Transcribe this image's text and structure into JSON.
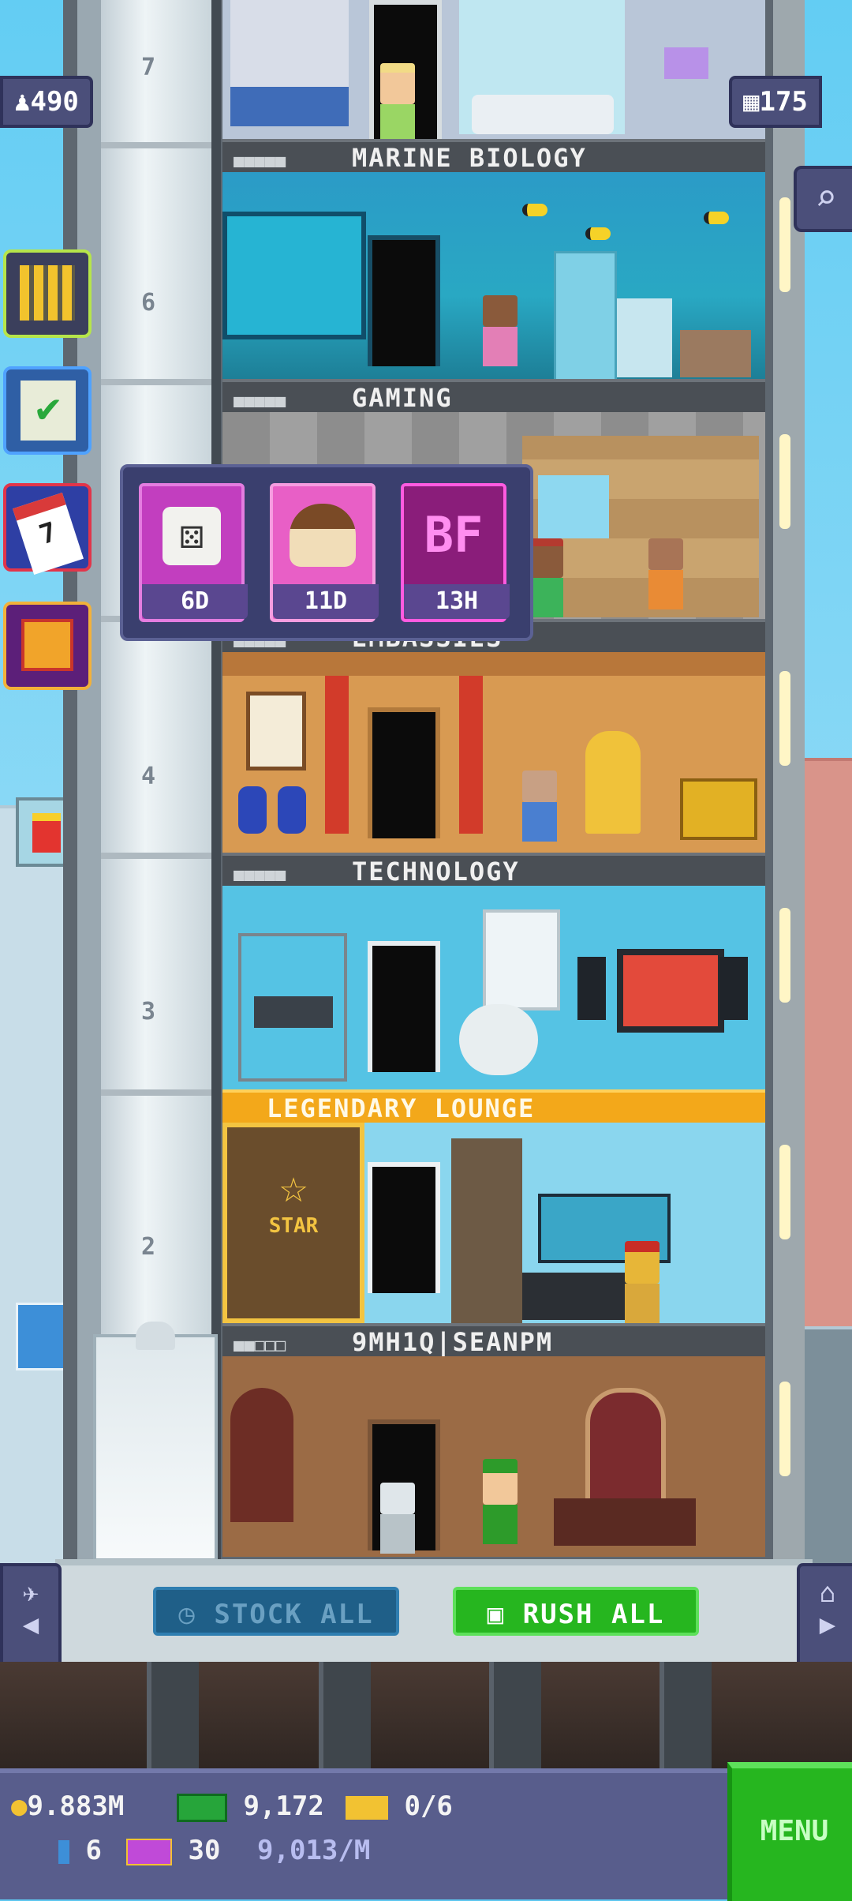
{
  "counters": {
    "population": "490",
    "floors": "175"
  },
  "floors": [
    {
      "label": "MARINE BIOLOGY",
      "legendary": false
    },
    {
      "label": "GAMING",
      "legendary": false
    },
    {
      "label": "EMBASSIES",
      "legendary": false
    },
    {
      "label": "TECHNOLOGY",
      "legendary": false
    },
    {
      "label": "LEGENDARY LOUNGE",
      "legendary": true
    },
    {
      "label": "9MH1Q|SEANPM",
      "legendary": false
    }
  ],
  "shaft_numbers": [
    "7",
    "6",
    "4",
    "3",
    "2"
  ],
  "popup": {
    "items": [
      {
        "icon": "dice-icon",
        "timer": "6D"
      },
      {
        "icon": "cream-puff-icon",
        "timer": "11D"
      },
      {
        "icon": "bf-logo-icon",
        "timer": "13H",
        "logo_text": "BF"
      }
    ]
  },
  "star_sign": "STAR",
  "sidebar": [
    {
      "icon": "calculator-icon"
    },
    {
      "icon": "checklist-icon"
    },
    {
      "icon": "calendar-icon",
      "text": "7"
    },
    {
      "icon": "gift-icon"
    }
  ],
  "lobby": {
    "stock_all": "STOCK ALL",
    "rush_all": "RUSH ALL"
  },
  "hud": {
    "coins": "9.883M",
    "bux": "9,172",
    "tickets": "0/6",
    "keys": "6",
    "vip": "30",
    "income": "9,013/M",
    "menu": "MENU"
  },
  "colors": {
    "legendary": "#f3a81a",
    "rush": "#26b61f",
    "stock": "#1f5f88",
    "hud": "#585d8c"
  }
}
